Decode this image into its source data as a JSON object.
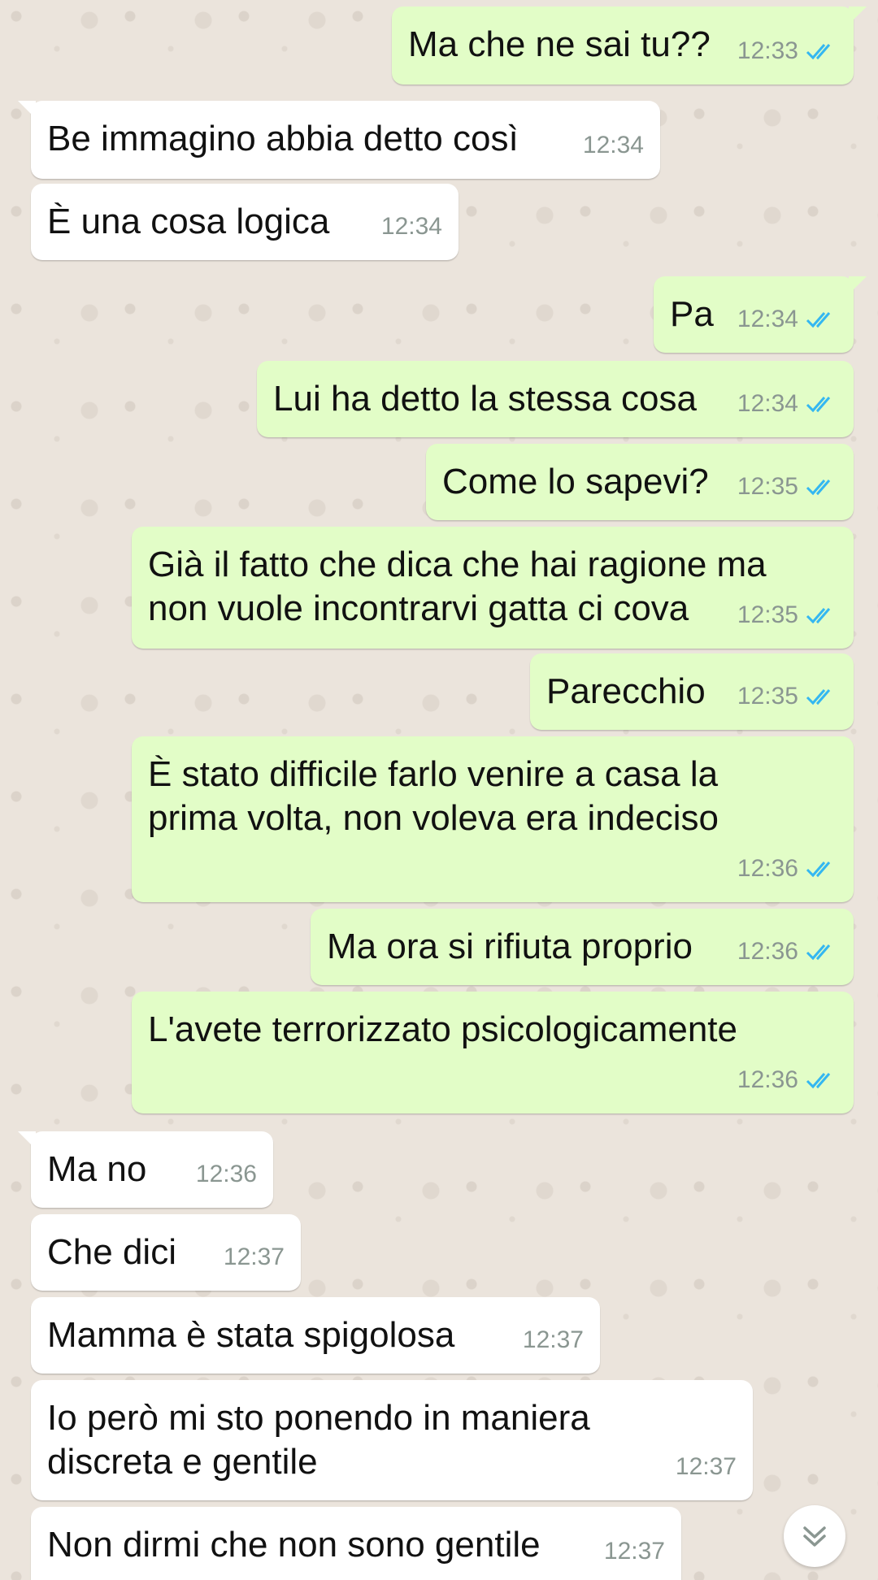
{
  "messages": [
    {
      "dir": "out",
      "text": "Ma che ne sai tu??",
      "time": "12:33",
      "read": true
    },
    {
      "dir": "in",
      "text": "Be immagino abbia detto così",
      "time": "12:34"
    },
    {
      "dir": "in",
      "text": "È una cosa logica",
      "time": "12:34"
    },
    {
      "dir": "out",
      "text": "Pa",
      "time": "12:34",
      "read": true
    },
    {
      "dir": "out",
      "text": "Lui ha detto la stessa cosa",
      "time": "12:34",
      "read": true
    },
    {
      "dir": "out",
      "text": "Come lo sapevi?",
      "time": "12:35",
      "read": true
    },
    {
      "dir": "out",
      "text": "Già il fatto che dica che hai ragione ma\nnon vuole incontrarvi gatta ci cova",
      "time": "12:35",
      "read": true
    },
    {
      "dir": "out",
      "text": "Parecchio",
      "time": "12:35",
      "read": true
    },
    {
      "dir": "out",
      "text": "È stato difficile farlo venire a casa la\nprima volta, non voleva era indeciso",
      "time": "12:36",
      "read": true
    },
    {
      "dir": "out",
      "text": "Ma ora si rifiuta proprio",
      "time": "12:36",
      "read": true
    },
    {
      "dir": "out",
      "text": "L'avete terrorizzato psicologicamente",
      "time": "12:36",
      "read": true
    },
    {
      "dir": "in",
      "text": "Ma no",
      "time": "12:36"
    },
    {
      "dir": "in",
      "text": "Che dici",
      "time": "12:37"
    },
    {
      "dir": "in",
      "text": "Mamma è stata spigolosa",
      "time": "12:37"
    },
    {
      "dir": "in",
      "text": "Io però mi sto ponendo in maniera\ndiscreta e gentile",
      "time": "12:37"
    },
    {
      "dir": "in",
      "text": "Non dirmi che non sono gentile",
      "time": "12:37"
    }
  ],
  "colors": {
    "outgoing_bubble": "#e2fdc7",
    "incoming_bubble": "#ffffff",
    "read_ticks": "#34b7f1",
    "wallpaper": "#ebe4dc"
  },
  "icons": {
    "scroll_down": "double-chevron-down-icon",
    "read_receipt": "double-check-icon"
  }
}
